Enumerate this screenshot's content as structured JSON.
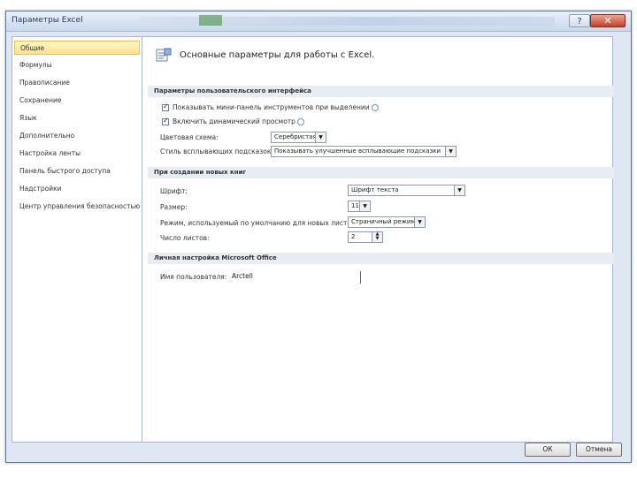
{
  "window": {
    "title": "Параметры Excel",
    "help_label": "?",
    "close_label": "✕"
  },
  "nav": {
    "items": [
      {
        "label": "Общие",
        "active": true
      },
      {
        "label": "Формулы"
      },
      {
        "label": "Правописание"
      },
      {
        "label": "Сохранение"
      },
      {
        "label": "Язык"
      },
      {
        "label": "Дополнительно"
      },
      {
        "label": "Настройка ленты"
      },
      {
        "label": "Панель быстрого доступа"
      },
      {
        "label": "Надстройки"
      },
      {
        "label": "Центр управления безопасностью"
      }
    ]
  },
  "main": {
    "header": "Основные параметры для работы с Excel.",
    "section_ui": "Параметры пользовательского интерфейса",
    "opt_minitoolbar": "Показывать мини-панель инструментов при выделении",
    "opt_livepreview": "Включить динамический просмотр",
    "color_scheme_label": "Цветовая схема:",
    "color_scheme_value": "Серебристая",
    "tooltip_style_label": "Стиль всплывающих подсказок:",
    "tooltip_style_value": "Показывать улучшенные всплывающие подсказки",
    "section_newbook": "При создании новых книг",
    "font_label": "Шрифт:",
    "font_value": "Шрифт текста",
    "size_label": "Размер:",
    "size_value": "11",
    "view_label": "Режим, используемый по умолчанию для новых листов:",
    "view_value": "Страничный режим",
    "sheets_label": "Число листов:",
    "sheets_value": "2",
    "section_personal": "Личная настройка Microsoft Office",
    "username_label": "Имя пользователя:",
    "username_value": "Arctell"
  },
  "footer": {
    "ok": "ОК",
    "cancel": "Отмена"
  },
  "colors": {
    "accent_active": "#ffe38a",
    "close_red": "#c4412c",
    "section_bg": "#e8edf4"
  }
}
